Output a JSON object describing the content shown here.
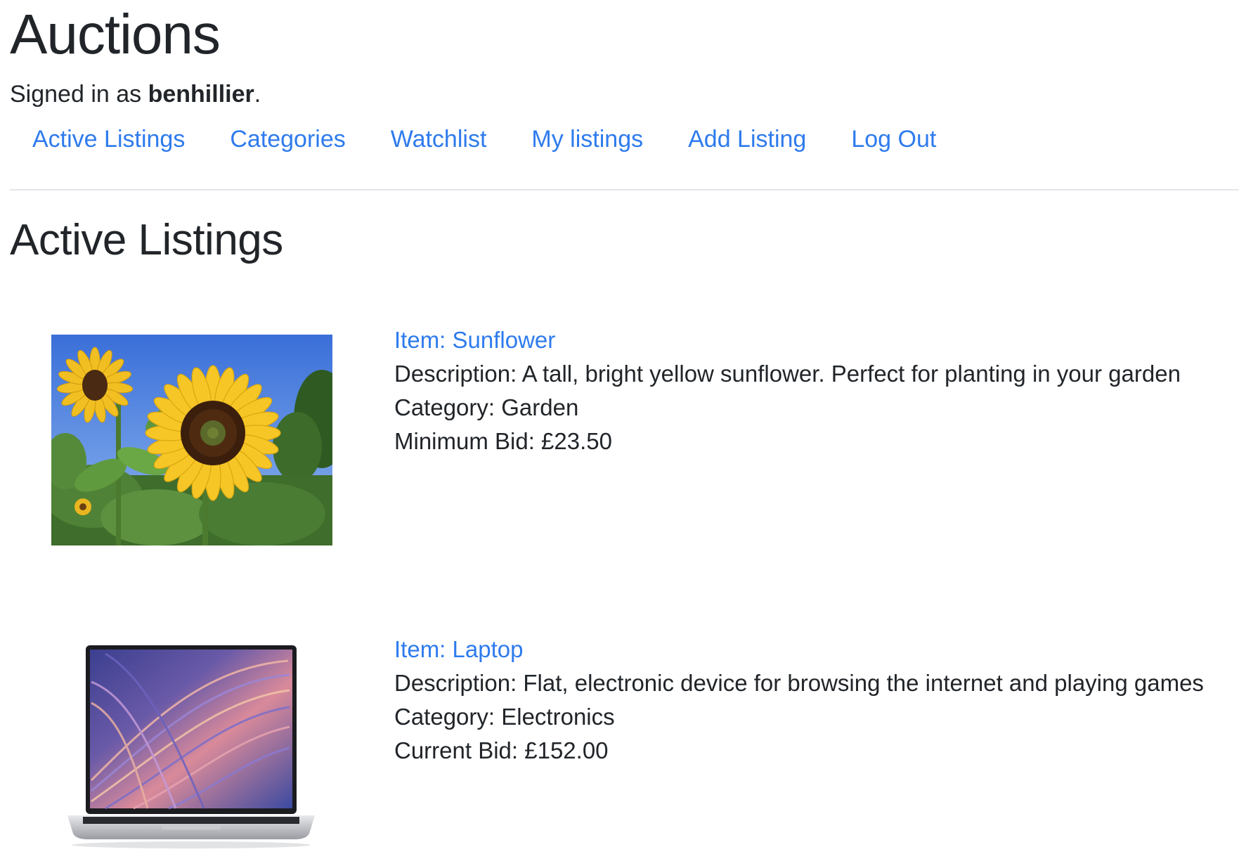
{
  "header": {
    "title": "Auctions",
    "signed_in_prefix": "Signed in as",
    "username": "benhillier",
    "signed_in_suffix": "."
  },
  "nav": {
    "items": [
      {
        "label": "Active Listings"
      },
      {
        "label": "Categories"
      },
      {
        "label": "Watchlist"
      },
      {
        "label": "My listings"
      },
      {
        "label": "Add Listing"
      },
      {
        "label": "Log Out"
      }
    ],
    "link_color": "#2e7bed"
  },
  "main": {
    "heading": "Active Listings",
    "listings": [
      {
        "title": "Item: Sunflower",
        "description": "Description: A tall, bright yellow sunflower. Perfect for planting in your garden",
        "category": "Category: Garden",
        "bid": "Minimum Bid: £23.50",
        "image_icon": "sunflower-photo"
      },
      {
        "title": "Item: Laptop",
        "description": "Description: Flat, electronic device for browsing the internet and playing games",
        "category": "Category: Electronics",
        "bid": "Current Bid: £152.00",
        "image_icon": "laptop-photo"
      }
    ]
  }
}
